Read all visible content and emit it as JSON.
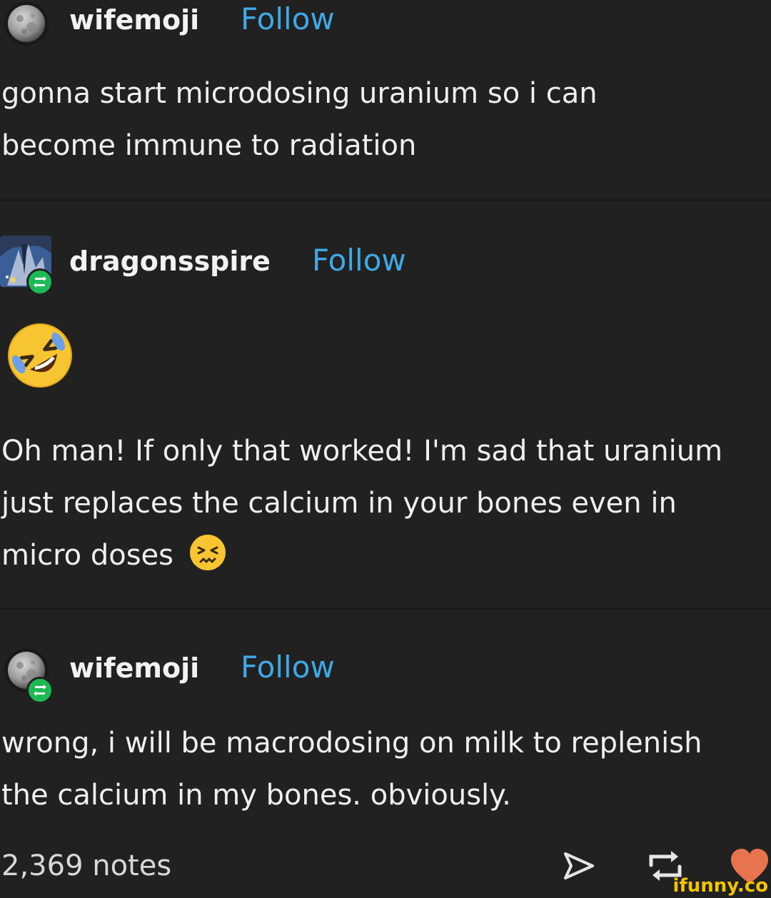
{
  "posts": [
    {
      "username": "wifemoji",
      "follow_label": "Follow",
      "text": "gonna start microdosing uranium so i can\nbecome immune to radiation"
    },
    {
      "username": "dragonsspire",
      "follow_label": "Follow",
      "text_lines": [
        "Oh man! If only that worked! I'm sad that uranium",
        "just replaces the calcium in your bones even in",
        "micro doses"
      ]
    },
    {
      "username": "wifemoji",
      "follow_label": "Follow",
      "text": "wrong, i will be macrodosing on milk to replenish\nthe calcium in my bones. obviously."
    }
  ],
  "footer": {
    "notes": "2,369 notes"
  },
  "watermark": "ifunny.co",
  "colors": {
    "background": "#212121",
    "follow": "#3fa9e6",
    "reblog_badge": "#1db954",
    "like": "#e8744f"
  },
  "icons": [
    "moon-avatar-icon",
    "dragon-avatar-icon",
    "reblog-badge-icon",
    "rolling-laughing-emoji-icon",
    "persevering-face-emoji-icon",
    "share-icon",
    "reblog-icon",
    "heart-icon"
  ]
}
